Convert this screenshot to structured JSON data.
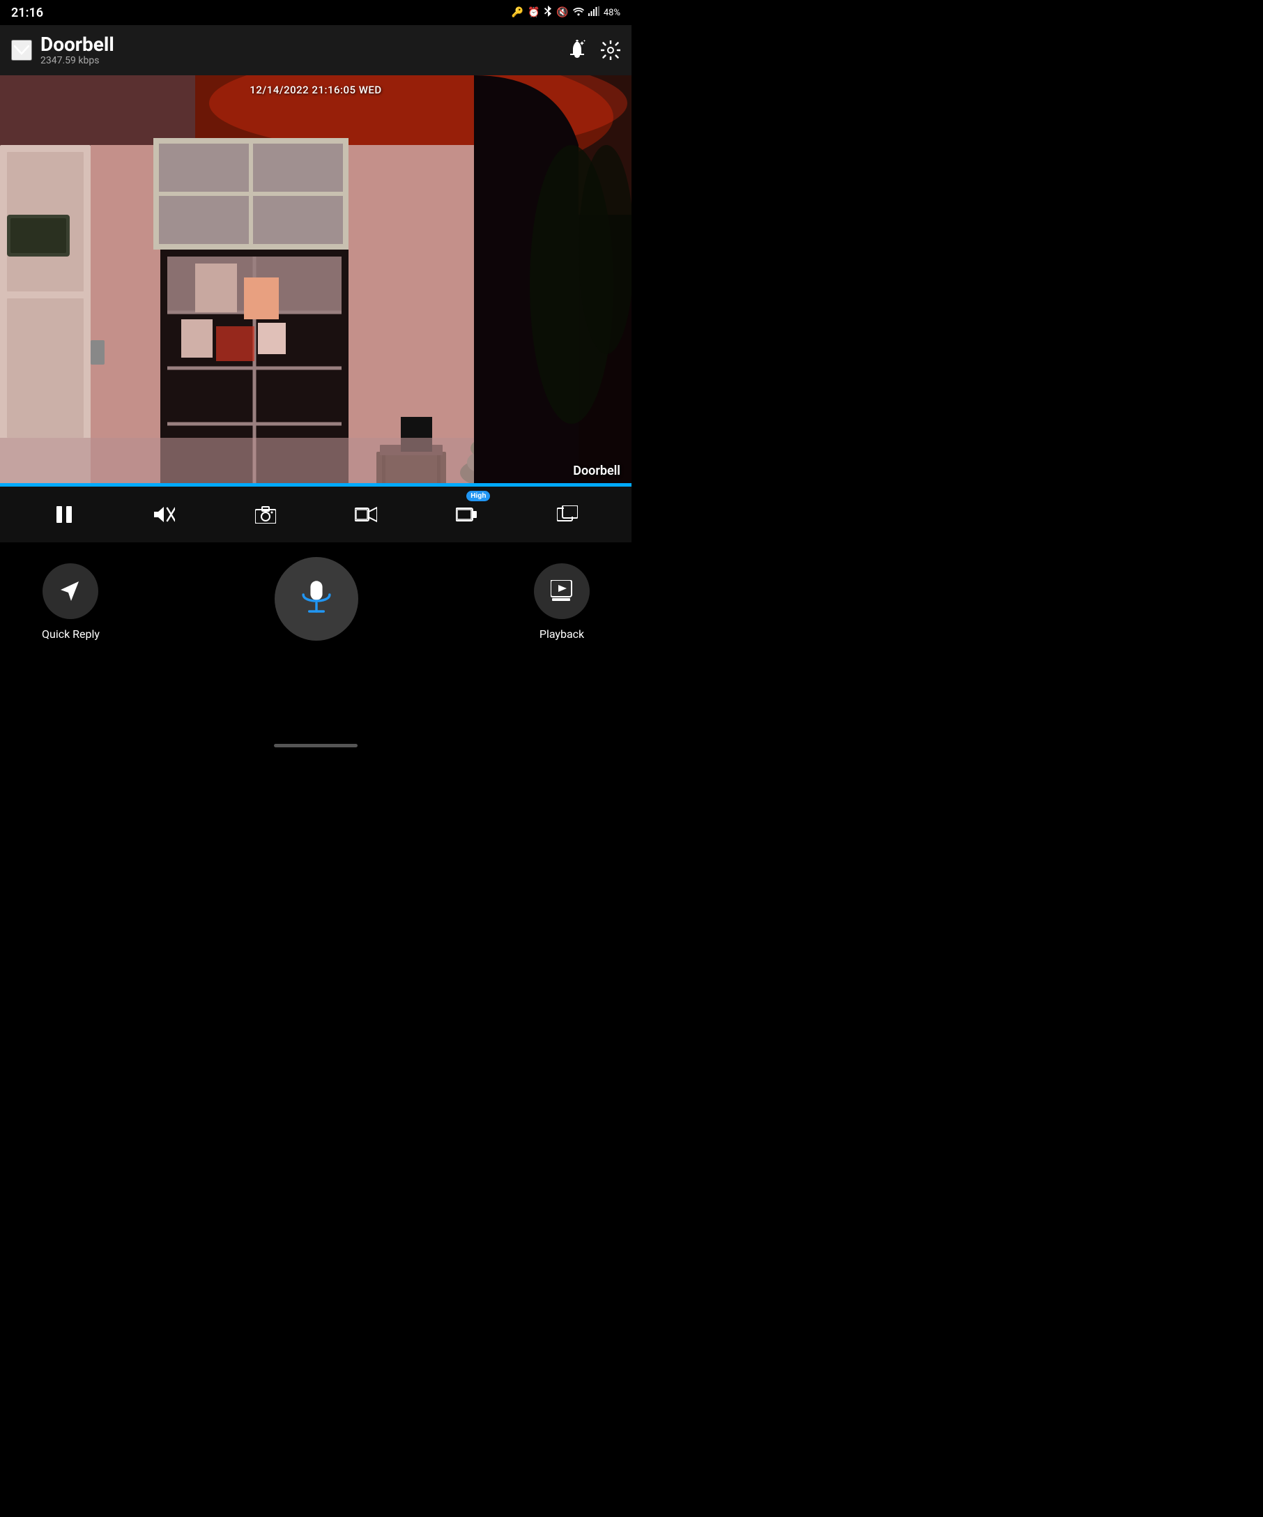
{
  "statusBar": {
    "time": "21:16",
    "battery": "48%",
    "icons": [
      "key-icon",
      "alarm-icon",
      "bluetooth-icon",
      "mute-icon",
      "wifi-icon",
      "signal-icon"
    ]
  },
  "header": {
    "title": "Doorbell",
    "subtitle": "2347.59 kbps",
    "chevronLabel": "back-chevron",
    "bellLabel": "alert-bell",
    "settingsLabel": "settings-gear"
  },
  "cameraFeed": {
    "timestamp": "12/14/2022  21:16:05 WED",
    "cameraName": "Doorbell",
    "blueBarColor": "#00aaff"
  },
  "controlsBar": {
    "pause": "pause-icon",
    "mute": "mute-speaker-icon",
    "snapshot": "camera-icon",
    "record": "video-icon",
    "quality": "quality-icon",
    "highBadge": "High",
    "fullscreen": "fullscreen-icon"
  },
  "bottomActions": {
    "quickReply": {
      "label": "Quick Reply",
      "icon": "send-icon"
    },
    "mic": {
      "label": "microphone"
    },
    "playback": {
      "label": "Playback",
      "icon": "play-icon"
    }
  },
  "colors": {
    "background": "#000000",
    "headerBg": "#1a1a1a",
    "controlsBg": "#111111",
    "accent": "#2196F3",
    "text": "#ffffff",
    "subtext": "#aaaaaa"
  }
}
